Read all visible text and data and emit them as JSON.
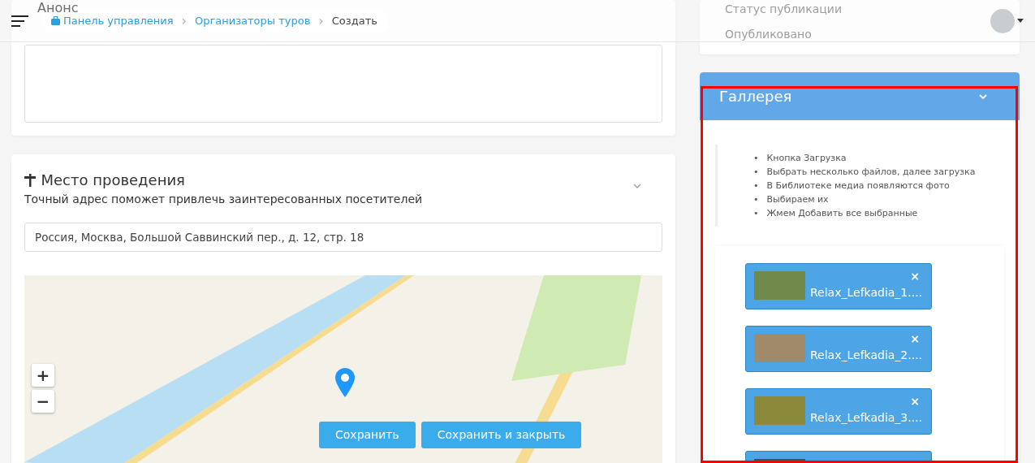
{
  "header": {
    "separator": "›",
    "breadcrumbs": [
      {
        "label": "Панель управления",
        "kind": "home"
      },
      {
        "label": "Организаторы туров",
        "kind": "link"
      },
      {
        "label": "Создать",
        "kind": "current"
      }
    ]
  },
  "announcement": {
    "title": "Анонс"
  },
  "venue": {
    "title": "Место проведения",
    "subtitle": "Точный адрес поможет привлечь заинтересованных посетителей",
    "address": "Россия, Москва, Большой Саввинский пер., д. 12, стр. 18",
    "map": {
      "zoom_in": "+",
      "zoom_out": "−"
    }
  },
  "status": {
    "label": "Статус публикации",
    "value": "Опубликовано"
  },
  "gallery": {
    "title": "Галлерея",
    "expanded": true,
    "bullet": "•",
    "instructions": [
      "Кнопка Загрузка",
      "Выбрать несколько файлов, далее загрузка",
      "В Библиотеке медиа появляются фото",
      "Выбираем их",
      "Жмем Добавить все выбранные"
    ],
    "files": [
      {
        "name": "Relax_Lefkadia_1....",
        "remove": "×",
        "color": "#6f8a4a"
      },
      {
        "name": "Relax_Lefkadia_2....",
        "remove": "×",
        "color": "#a08a6a"
      },
      {
        "name": "Relax_Lefkadia_3....",
        "remove": "×",
        "color": "#8a8a3a"
      },
      {
        "color": "#5a4a40"
      }
    ]
  },
  "actions": [
    "Сохранить",
    "Сохранить и закрыть"
  ]
}
